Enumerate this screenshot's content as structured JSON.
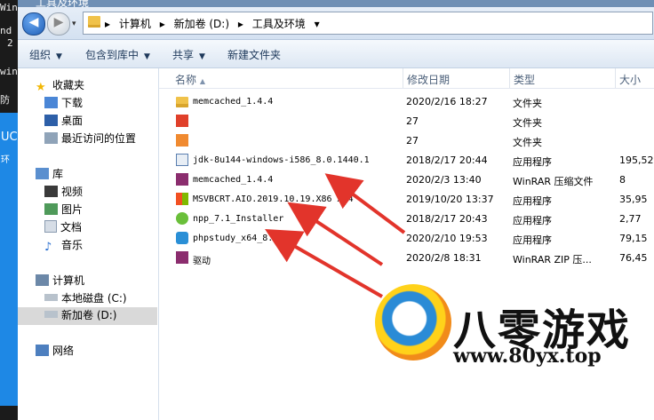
{
  "window": {
    "title": "工具及环境"
  },
  "left_strip": {
    "lines": [
      "Win",
      "nd",
      "2",
      "win",
      "防",
      "UC",
      "环"
    ]
  },
  "address": {
    "crumbs": [
      "计算机",
      "新加卷 (D:)",
      "工具及环境"
    ],
    "separator": "▸",
    "dropdown": "▾",
    "back_glyph": "◀",
    "forward_glyph": "▶",
    "recent_glyph": "▾"
  },
  "toolbar": {
    "organize": "组织",
    "include_library": "包含到库中",
    "share": "共享",
    "new_folder": "新建文件夹",
    "dropdown_glyph": "▼"
  },
  "nav": {
    "favorites": "收藏夹",
    "downloads": "下载",
    "desktop": "桌面",
    "recent": "最近访问的位置",
    "libraries": "库",
    "videos": "视频",
    "pictures": "图片",
    "documents": "文档",
    "music": "音乐",
    "computer": "计算机",
    "local_disk": "本地磁盘 (C:)",
    "new_volume": "新加卷 (D:)",
    "network": "网络"
  },
  "columns": {
    "name": "名称",
    "date": "修改日期",
    "type": "类型",
    "size": "大小",
    "sort_glyph": "▲"
  },
  "files": [
    {
      "name": "memcached_1.4.4",
      "date": "2020/2/16 18:27",
      "type": "文件夹",
      "size": "",
      "icon": "folder-icon",
      "color": "#f0c24a"
    },
    {
      "name": "",
      "date": "27",
      "type": "文件夹",
      "size": "",
      "icon": "app-red-icon",
      "color": "#e0402a"
    },
    {
      "name": "",
      "date": "27",
      "type": "文件夹",
      "size": "",
      "icon": "app-orange-icon",
      "color": "#f08a30"
    },
    {
      "name": "jdk-8u144-windows-i586_8.0.1440.1",
      "date": "2018/2/17 20:44",
      "type": "应用程序",
      "size": "195,52",
      "icon": "java-icon",
      "color": "#5a7fb0"
    },
    {
      "name": "memcached_1.4.4",
      "date": "2020/2/3 13:40",
      "type": "WinRAR 压缩文件",
      "size": "8",
      "icon": "winrar-icon",
      "color": "#8b2d6e"
    },
    {
      "name": "MSVBCRT.AIO.2019.10.19.X86 X64",
      "date": "2019/10/20 13:37",
      "type": "应用程序",
      "size": "35,95",
      "icon": "windows-icon",
      "color": "#2f7de1"
    },
    {
      "name": "npp_7.1_Installer",
      "date": "2018/2/17 20:43",
      "type": "应用程序",
      "size": "2,77",
      "icon": "notepadpp-icon",
      "color": "#6abf3a"
    },
    {
      "name": "phpstudy_x64_8.1.0.3",
      "date": "2020/2/10 19:53",
      "type": "应用程序",
      "size": "79,15",
      "icon": "phpstudy-icon",
      "color": "#2a8fd6"
    },
    {
      "name": "驱动",
      "date": "2020/2/8 18:31",
      "type": "WinRAR ZIP 压...",
      "size": "76,45",
      "icon": "winrar-icon",
      "color": "#8b2d6e"
    }
  ],
  "watermark": {
    "title": "八零游戏",
    "url": "www.80yx.top"
  },
  "annotation_color": "#e2342b"
}
